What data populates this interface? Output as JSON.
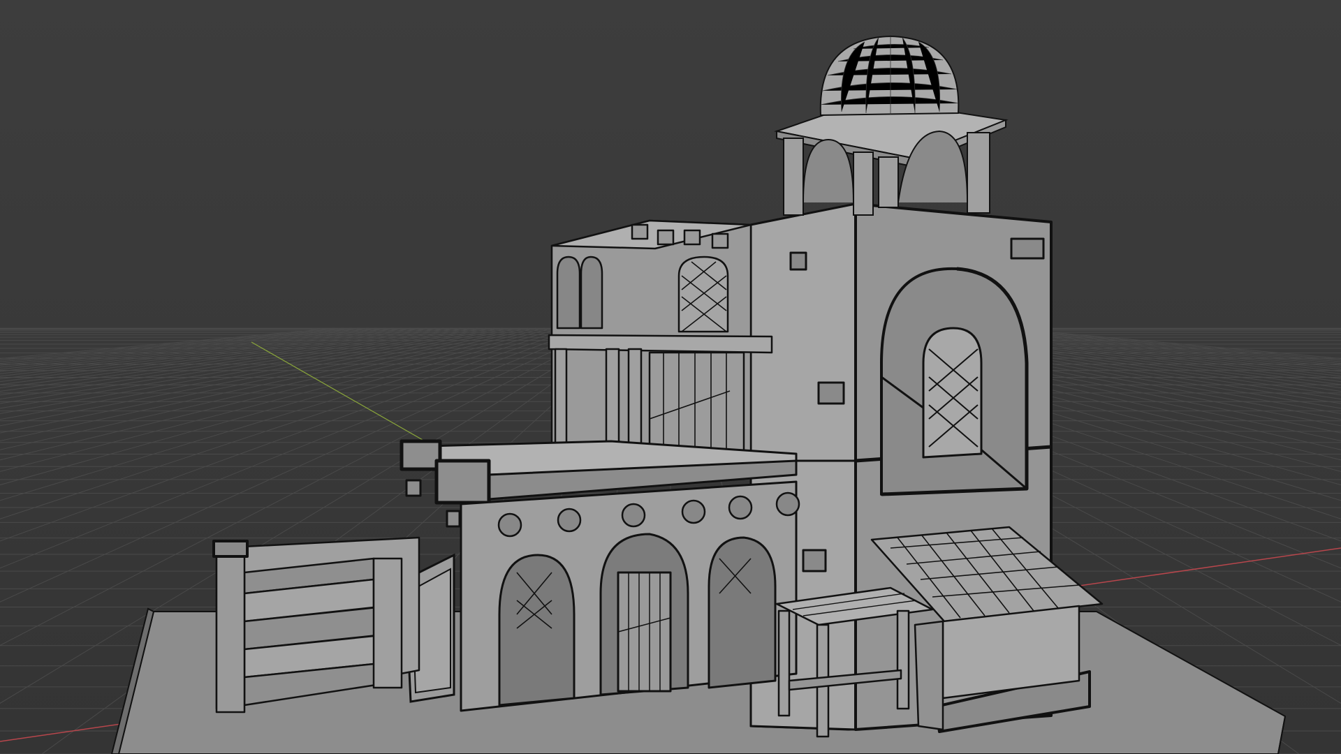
{
  "viewport": {
    "mode": "3D viewport",
    "shading": "solid",
    "colors": {
      "background": "#3a3a3a",
      "grid_line": "#4a4a4a",
      "x_axis": "#b8464c",
      "y_axis": "#8aa63a",
      "mesh_fill": "#9a9a9a",
      "mesh_light": "#b3b3b3",
      "mesh_shade": "#7e7e7e",
      "outline": "#111111"
    }
  },
  "scene": {
    "objects": [
      "ground-base",
      "left-staircase",
      "front-arcade-wall",
      "main-tower",
      "dome-pavilion",
      "upper-balcony-room",
      "tiled-awning",
      "wooden-table",
      "wooden-door"
    ]
  }
}
